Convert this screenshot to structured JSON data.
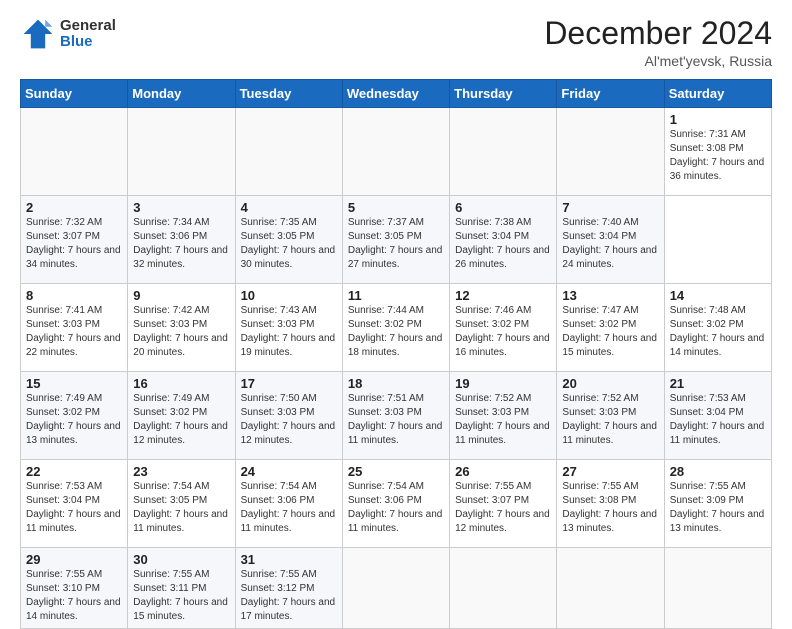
{
  "header": {
    "logo": {
      "general": "General",
      "blue": "Blue"
    },
    "title": "December 2024",
    "location": "Al'met'yevsk, Russia"
  },
  "calendar": {
    "days_of_week": [
      "Sunday",
      "Monday",
      "Tuesday",
      "Wednesday",
      "Thursday",
      "Friday",
      "Saturday"
    ],
    "weeks": [
      [
        null,
        null,
        null,
        null,
        null,
        null,
        {
          "day": 1,
          "sunrise": "Sunrise: 7:31 AM",
          "sunset": "Sunset: 3:08 PM",
          "daylight": "Daylight: 7 hours and 36 minutes."
        }
      ],
      [
        {
          "day": 2,
          "sunrise": "Sunrise: 7:32 AM",
          "sunset": "Sunset: 3:07 PM",
          "daylight": "Daylight: 7 hours and 34 minutes."
        },
        {
          "day": 3,
          "sunrise": "Sunrise: 7:34 AM",
          "sunset": "Sunset: 3:06 PM",
          "daylight": "Daylight: 7 hours and 32 minutes."
        },
        {
          "day": 4,
          "sunrise": "Sunrise: 7:35 AM",
          "sunset": "Sunset: 3:05 PM",
          "daylight": "Daylight: 7 hours and 30 minutes."
        },
        {
          "day": 5,
          "sunrise": "Sunrise: 7:37 AM",
          "sunset": "Sunset: 3:05 PM",
          "daylight": "Daylight: 7 hours and 27 minutes."
        },
        {
          "day": 6,
          "sunrise": "Sunrise: 7:38 AM",
          "sunset": "Sunset: 3:04 PM",
          "daylight": "Daylight: 7 hours and 26 minutes."
        },
        {
          "day": 7,
          "sunrise": "Sunrise: 7:40 AM",
          "sunset": "Sunset: 3:04 PM",
          "daylight": "Daylight: 7 hours and 24 minutes."
        }
      ],
      [
        {
          "day": 8,
          "sunrise": "Sunrise: 7:41 AM",
          "sunset": "Sunset: 3:03 PM",
          "daylight": "Daylight: 7 hours and 22 minutes."
        },
        {
          "day": 9,
          "sunrise": "Sunrise: 7:42 AM",
          "sunset": "Sunset: 3:03 PM",
          "daylight": "Daylight: 7 hours and 20 minutes."
        },
        {
          "day": 10,
          "sunrise": "Sunrise: 7:43 AM",
          "sunset": "Sunset: 3:03 PM",
          "daylight": "Daylight: 7 hours and 19 minutes."
        },
        {
          "day": 11,
          "sunrise": "Sunrise: 7:44 AM",
          "sunset": "Sunset: 3:02 PM",
          "daylight": "Daylight: 7 hours and 18 minutes."
        },
        {
          "day": 12,
          "sunrise": "Sunrise: 7:46 AM",
          "sunset": "Sunset: 3:02 PM",
          "daylight": "Daylight: 7 hours and 16 minutes."
        },
        {
          "day": 13,
          "sunrise": "Sunrise: 7:47 AM",
          "sunset": "Sunset: 3:02 PM",
          "daylight": "Daylight: 7 hours and 15 minutes."
        },
        {
          "day": 14,
          "sunrise": "Sunrise: 7:48 AM",
          "sunset": "Sunset: 3:02 PM",
          "daylight": "Daylight: 7 hours and 14 minutes."
        }
      ],
      [
        {
          "day": 15,
          "sunrise": "Sunrise: 7:49 AM",
          "sunset": "Sunset: 3:02 PM",
          "daylight": "Daylight: 7 hours and 13 minutes."
        },
        {
          "day": 16,
          "sunrise": "Sunrise: 7:49 AM",
          "sunset": "Sunset: 3:02 PM",
          "daylight": "Daylight: 7 hours and 12 minutes."
        },
        {
          "day": 17,
          "sunrise": "Sunrise: 7:50 AM",
          "sunset": "Sunset: 3:03 PM",
          "daylight": "Daylight: 7 hours and 12 minutes."
        },
        {
          "day": 18,
          "sunrise": "Sunrise: 7:51 AM",
          "sunset": "Sunset: 3:03 PM",
          "daylight": "Daylight: 7 hours and 11 minutes."
        },
        {
          "day": 19,
          "sunrise": "Sunrise: 7:52 AM",
          "sunset": "Sunset: 3:03 PM",
          "daylight": "Daylight: 7 hours and 11 minutes."
        },
        {
          "day": 20,
          "sunrise": "Sunrise: 7:52 AM",
          "sunset": "Sunset: 3:03 PM",
          "daylight": "Daylight: 7 hours and 11 minutes."
        },
        {
          "day": 21,
          "sunrise": "Sunrise: 7:53 AM",
          "sunset": "Sunset: 3:04 PM",
          "daylight": "Daylight: 7 hours and 11 minutes."
        }
      ],
      [
        {
          "day": 22,
          "sunrise": "Sunrise: 7:53 AM",
          "sunset": "Sunset: 3:04 PM",
          "daylight": "Daylight: 7 hours and 11 minutes."
        },
        {
          "day": 23,
          "sunrise": "Sunrise: 7:54 AM",
          "sunset": "Sunset: 3:05 PM",
          "daylight": "Daylight: 7 hours and 11 minutes."
        },
        {
          "day": 24,
          "sunrise": "Sunrise: 7:54 AM",
          "sunset": "Sunset: 3:06 PM",
          "daylight": "Daylight: 7 hours and 11 minutes."
        },
        {
          "day": 25,
          "sunrise": "Sunrise: 7:54 AM",
          "sunset": "Sunset: 3:06 PM",
          "daylight": "Daylight: 7 hours and 11 minutes."
        },
        {
          "day": 26,
          "sunrise": "Sunrise: 7:55 AM",
          "sunset": "Sunset: 3:07 PM",
          "daylight": "Daylight: 7 hours and 12 minutes."
        },
        {
          "day": 27,
          "sunrise": "Sunrise: 7:55 AM",
          "sunset": "Sunset: 3:08 PM",
          "daylight": "Daylight: 7 hours and 13 minutes."
        },
        {
          "day": 28,
          "sunrise": "Sunrise: 7:55 AM",
          "sunset": "Sunset: 3:09 PM",
          "daylight": "Daylight: 7 hours and 13 minutes."
        }
      ],
      [
        {
          "day": 29,
          "sunrise": "Sunrise: 7:55 AM",
          "sunset": "Sunset: 3:10 PM",
          "daylight": "Daylight: 7 hours and 14 minutes."
        },
        {
          "day": 30,
          "sunrise": "Sunrise: 7:55 AM",
          "sunset": "Sunset: 3:11 PM",
          "daylight": "Daylight: 7 hours and 15 minutes."
        },
        {
          "day": 31,
          "sunrise": "Sunrise: 7:55 AM",
          "sunset": "Sunset: 3:12 PM",
          "daylight": "Daylight: 7 hours and 17 minutes."
        },
        null,
        null,
        null,
        null
      ]
    ]
  }
}
